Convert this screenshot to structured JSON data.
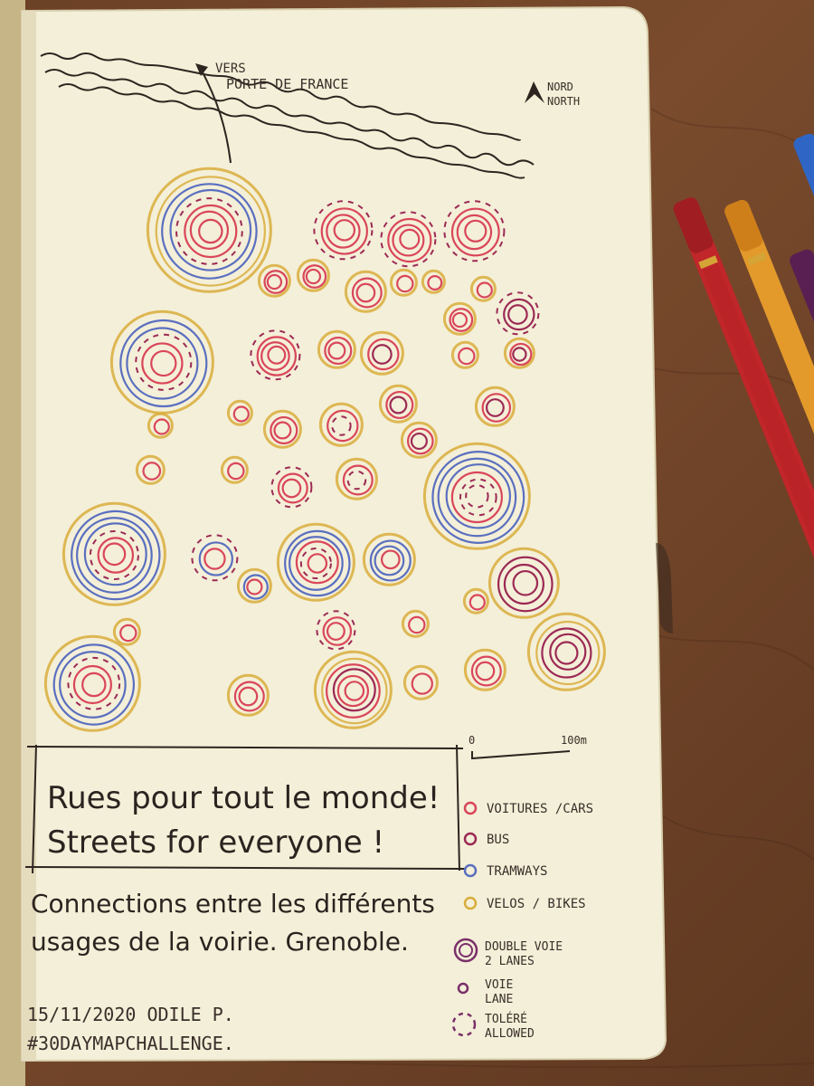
{
  "header": {
    "direction_arrow_label_1": "VERS",
    "direction_arrow_label_2": "PORTE DE FRANCE",
    "north_label_1": "NORD",
    "north_label_2": "NORTH"
  },
  "scale_bar": {
    "start": "0",
    "end": "100m"
  },
  "title_box": {
    "line_fr": "Rues pour tout le monde!",
    "line_en": "Streets for everyone !"
  },
  "subtitle": {
    "line1": "Connections entre les différents",
    "line2": "usages de la voirie. Grenoble."
  },
  "signature": {
    "line1": "15/11/2020 ODILE P.",
    "line2": "#30DAYMAPCHALLENGE."
  },
  "legend": {
    "items": [
      {
        "label": "VOITURES /CARS",
        "color": "#d9465a",
        "style": "ring"
      },
      {
        "label": "BUS",
        "color": "#9c2a55",
        "style": "ring"
      },
      {
        "label": "TRAMWAYS",
        "color": "#5a6fc0",
        "style": "ring"
      },
      {
        "label": "VELOS / BIKES",
        "color": "#d8ad3c",
        "style": "ring"
      }
    ],
    "lanes": [
      {
        "label_1": "DOUBLE VOIE",
        "label_2": "2 LANES",
        "style": "double"
      },
      {
        "label_1": "VOIE",
        "label_2": "LANE",
        "style": "single"
      },
      {
        "label_1": "TOLÉRÉ",
        "label_2": "ALLOWED",
        "style": "dashed"
      }
    ]
  },
  "colors": {
    "cars": "#d9465a",
    "bus": "#9c2a55",
    "tram": "#5a6fc0",
    "bikes": "#d8ad3c",
    "paper": "#f4efd8",
    "wood": "#6b4126"
  },
  "circle_types": [
    "cars",
    "bus",
    "tram",
    "bikes",
    "dashed"
  ]
}
